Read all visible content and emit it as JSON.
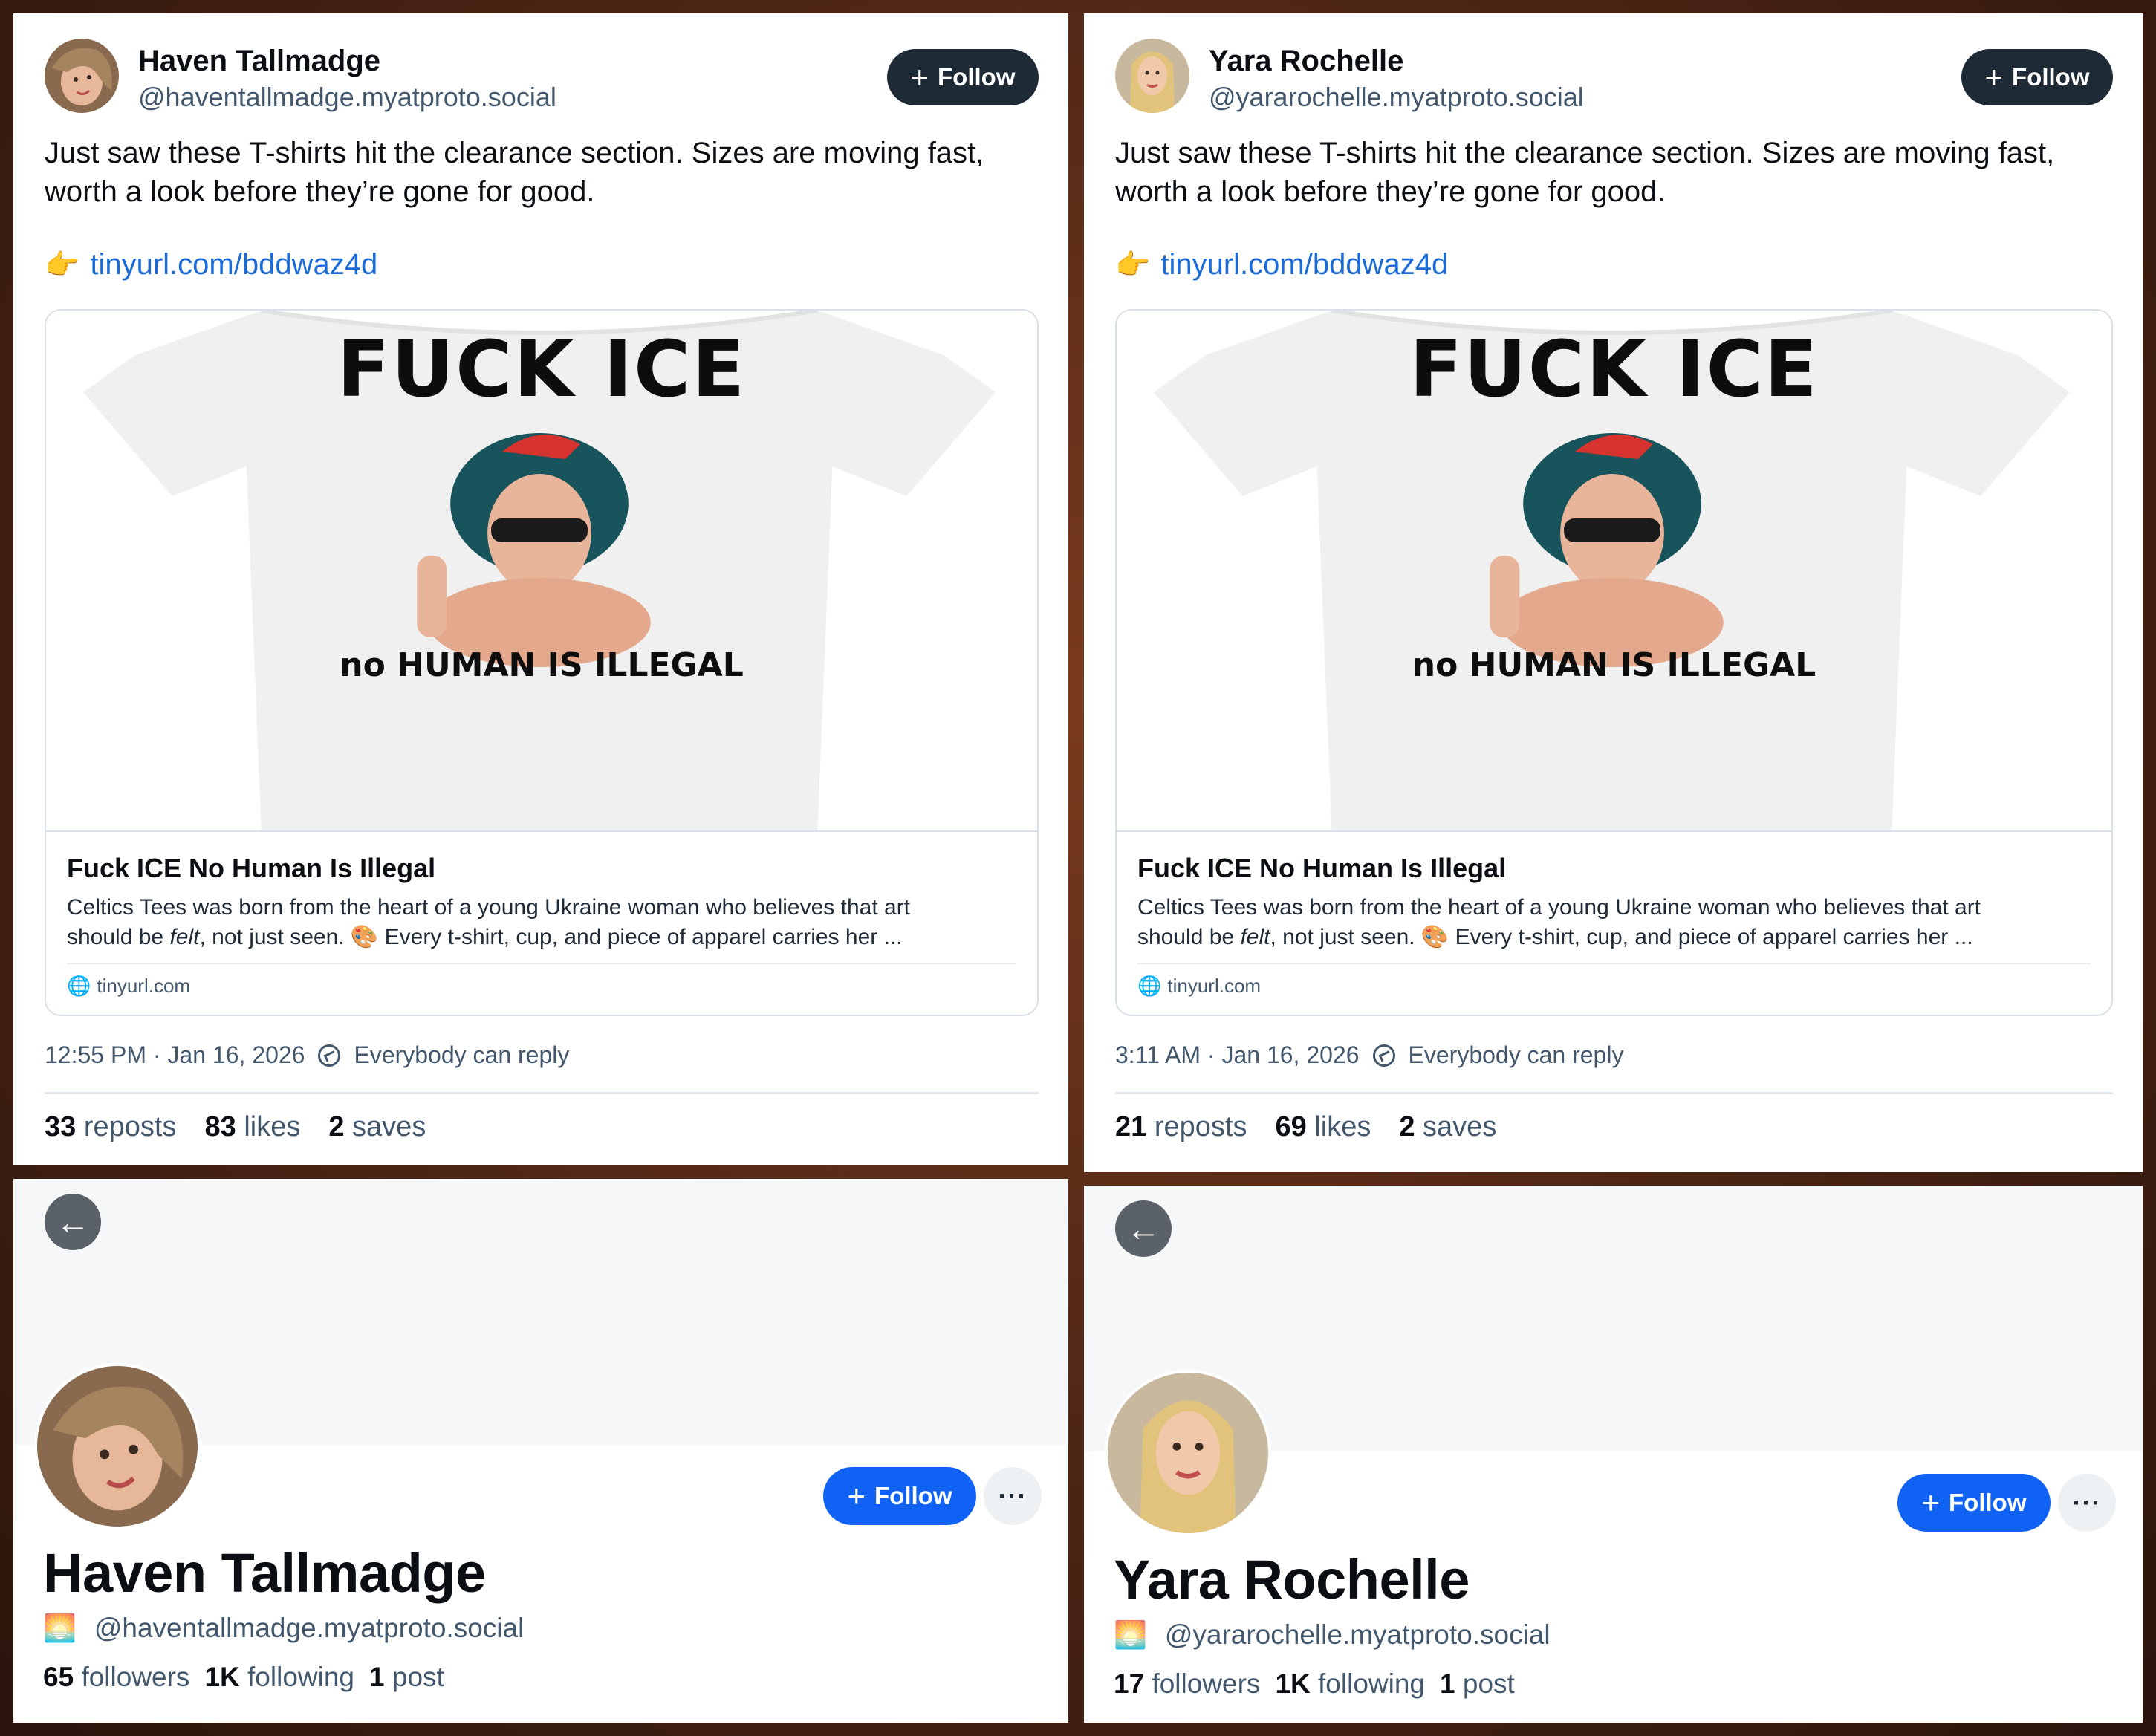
{
  "posts": [
    {
      "author_name": "Haven Tallmadge",
      "author_handle": "@haventallmadge.myatproto.social",
      "follow_label": "Follow",
      "text": "Just saw these T-shirts hit the clearance section. Sizes are moving fast, worth a look before they’re gone for good.",
      "link_icon": "👉",
      "link_text": "tinyurl.com/bddwaz4d",
      "shirt_headline": "FUCK ICE",
      "shirt_subtext": "no HUMAN IS ILLEGAL",
      "embed_title": "Fuck ICE No Human Is Illegal",
      "embed_desc_1": "Celtics Tees was born from the heart of a young Ukraine woman who believes that art",
      "embed_desc_2a": "should be ",
      "embed_desc_2_em": "felt",
      "embed_desc_2b": ", not just seen. 🎨 Every t-shirt, cup, and piece of apparel carries her ...",
      "embed_domain": "tinyurl.com",
      "timestamp": "12:55 PM · Jan 16, 2026",
      "reply_setting": "Everybody can reply",
      "reposts_count": "33",
      "reposts_label": "reposts",
      "likes_count": "83",
      "likes_label": "likes",
      "saves_count": "2",
      "saves_label": "saves"
    },
    {
      "author_name": "Yara Rochelle",
      "author_handle": "@yararochelle.myatproto.social",
      "follow_label": "Follow",
      "text": "Just saw these T-shirts hit the clearance section. Sizes are moving fast, worth a look before they’re gone for good.",
      "link_icon": "👉",
      "link_text": "tinyurl.com/bddwaz4d",
      "shirt_headline": "FUCK ICE",
      "shirt_subtext": "no HUMAN IS ILLEGAL",
      "embed_title": "Fuck ICE No Human Is Illegal",
      "embed_desc_1": "Celtics Tees was born from the heart of a young Ukraine woman who believes that art",
      "embed_desc_2a": "should be ",
      "embed_desc_2_em": "felt",
      "embed_desc_2b": ", not just seen. 🎨 Every t-shirt, cup, and piece of apparel carries her ...",
      "embed_domain": "tinyurl.com",
      "timestamp": "3:11 AM · Jan 16, 2026",
      "reply_setting": "Everybody can reply",
      "reposts_count": "21",
      "reposts_label": "reposts",
      "likes_count": "69",
      "likes_label": "likes",
      "saves_count": "2",
      "saves_label": "saves"
    }
  ],
  "profiles": [
    {
      "name": "Haven Tallmadge",
      "handle": "@haventallmadge.myatproto.social",
      "follow_label": "Follow",
      "more_label": "···",
      "back_icon": "arrow-left-icon",
      "followers_count": "65",
      "followers_label": "followers",
      "following_count": "1K",
      "following_label": "following",
      "posts_count": "1",
      "posts_label": "post"
    },
    {
      "name": "Yara Rochelle",
      "handle": "@yararochelle.myatproto.social",
      "follow_label": "Follow",
      "more_label": "···",
      "back_icon": "arrow-left-icon",
      "followers_count": "17",
      "followers_label": "followers",
      "following_count": "1K",
      "following_label": "following",
      "posts_count": "1",
      "posts_label": "post"
    }
  ],
  "colors": {
    "follow_dark": "#1f2a37",
    "follow_blue": "#1062f5",
    "link": "#1a6bd8",
    "muted_text": "#42576c"
  }
}
